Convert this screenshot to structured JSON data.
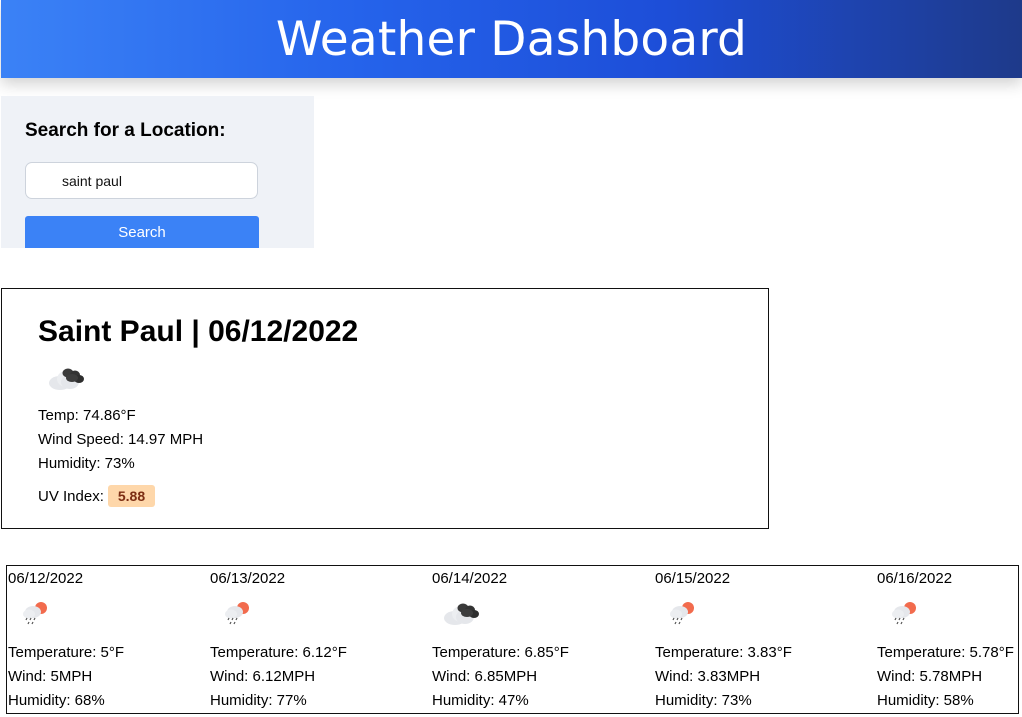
{
  "header": {
    "title": "Weather Dashboard"
  },
  "search": {
    "title": "Search for a Location:",
    "value": "saint paul",
    "button_label": "Search"
  },
  "current": {
    "title": "Saint Paul | 06/12/2022",
    "icon": "broken-clouds-icon",
    "temp": "Temp: 74.86°F",
    "wind": "Wind Speed: 14.97 MPH",
    "humidity": "Humidity: 73%",
    "uv_label": "UV Index:",
    "uv_value": "5.88",
    "uv_color": "#fed7aa"
  },
  "forecast": [
    {
      "date": "06/12/2022",
      "icon": "rain-icon",
      "temperature": "Temperature: 5°F",
      "wind": "Wind: 5MPH",
      "humidity": "Humidity: 68%"
    },
    {
      "date": "06/13/2022",
      "icon": "rain-icon",
      "temperature": "Temperature: 6.12°F",
      "wind": "Wind: 6.12MPH",
      "humidity": "Humidity: 77%"
    },
    {
      "date": "06/14/2022",
      "icon": "broken-clouds-icon",
      "temperature": "Temperature: 6.85°F",
      "wind": "Wind: 6.85MPH",
      "humidity": "Humidity: 47%"
    },
    {
      "date": "06/15/2022",
      "icon": "rain-icon",
      "temperature": "Temperature: 3.83°F",
      "wind": "Wind: 3.83MPH",
      "humidity": "Humidity: 73%"
    },
    {
      "date": "06/16/2022",
      "icon": "rain-icon",
      "temperature": "Temperature: 5.78°F",
      "wind": "Wind: 5.78MPH",
      "humidity": "Humidity: 58%"
    }
  ]
}
